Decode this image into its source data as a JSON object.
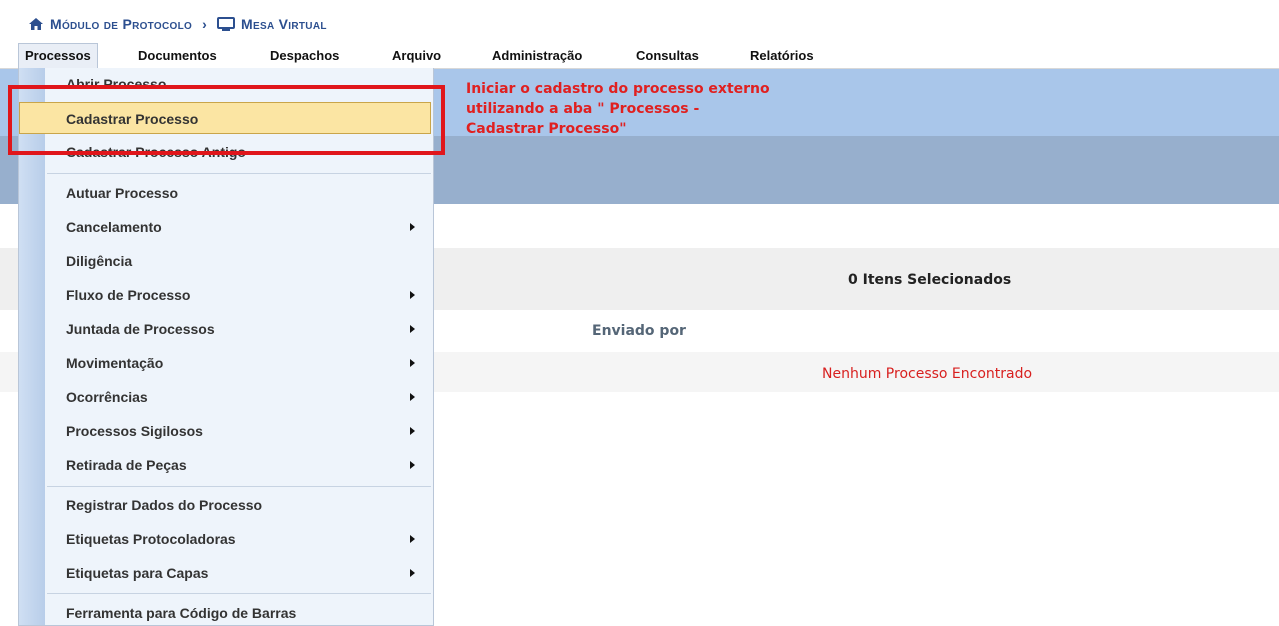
{
  "breadcrumb": {
    "home_label": "Módulo de Protocolo",
    "separator": "›",
    "current_label": "Mesa Virtual"
  },
  "menubar": {
    "items": [
      "Processos",
      "Documentos",
      "Despachos",
      "Arquivo",
      "Administração",
      "Consultas",
      "Relatórios"
    ],
    "active": "Processos"
  },
  "dropdown": {
    "items": [
      {
        "label": "Abrir Processo",
        "has_submenu": false
      },
      {
        "label": "Cadastrar Processo",
        "has_submenu": false,
        "highlighted": true
      },
      {
        "label": "Cadastrar Processo Antigo",
        "has_submenu": false
      },
      {
        "label": "Autuar Processo",
        "has_submenu": false
      },
      {
        "label": "Cancelamento",
        "has_submenu": true
      },
      {
        "label": "Diligência",
        "has_submenu": false
      },
      {
        "label": "Fluxo de Processo",
        "has_submenu": true
      },
      {
        "label": "Juntada de Processos",
        "has_submenu": true
      },
      {
        "label": "Movimentação",
        "has_submenu": true
      },
      {
        "label": "Ocorrências",
        "has_submenu": true
      },
      {
        "label": "Processos Sigilosos",
        "has_submenu": true
      },
      {
        "label": "Retirada de Peças",
        "has_submenu": true
      },
      {
        "label": "Registrar Dados do Processo",
        "has_submenu": false
      },
      {
        "label": "Etiquetas Protocoladoras",
        "has_submenu": true
      },
      {
        "label": "Etiquetas para Capas",
        "has_submenu": true
      },
      {
        "label": "Ferramenta para Código de Barras",
        "has_submenu": false
      }
    ]
  },
  "annotation": {
    "lines": [
      "Iniciar o cadastro do processo externo",
      "utilizando a aba \" Processos -",
      "Cadastrar Processo\""
    ],
    "color": "#e02020"
  },
  "main": {
    "selected_count_text": "0 Itens Selecionados",
    "column_header": "Enviado por",
    "empty_message": "Nenhum Processo Encontrado"
  },
  "colors": {
    "breadcrumb": "#2c4f8f",
    "band_light": "#a9c6ea",
    "band_dark": "#97afcd",
    "highlight": "#fbe5a3",
    "empty_message": "#d8201f"
  }
}
